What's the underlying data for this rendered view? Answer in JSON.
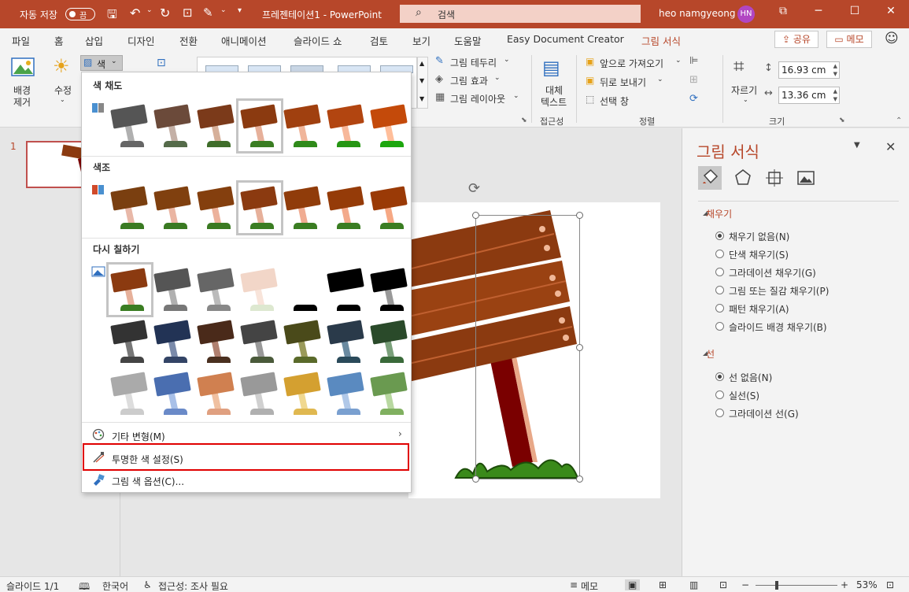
{
  "titlebar": {
    "autosave_label": "자동 저장",
    "autosave_state": "끔",
    "doc_title": "프레젠테이션1  -  PowerPoint",
    "search_placeholder": "검색",
    "user_name": "heo namgyeong",
    "user_initials": "HN",
    "accent": "#b7472a"
  },
  "tabs": [
    "파일",
    "홈",
    "삽입",
    "디자인",
    "전환",
    "애니메이션",
    "슬라이드 쇼",
    "검토",
    "보기",
    "도움말",
    "Easy Document Creator",
    "그림 서식"
  ],
  "active_tab": "그림 서식",
  "share_label": "공유",
  "memo_label": "메모",
  "ribbon": {
    "bg_remove": "배경\n제거",
    "bg_remove_l1": "배경",
    "bg_remove_l2": "제거",
    "correct": "수정",
    "color": "색",
    "picture_border": "그림 테두리",
    "picture_effects": "그림 효과",
    "picture_layout": "그림 레이아웃",
    "alt_text_l1": "대체",
    "alt_text_l2": "텍스트",
    "accessibility_group": "접근성",
    "bring_forward": "앞으로 가져오기",
    "send_backward": "뒤로 보내기",
    "selection_pane": "선택 창",
    "arrange_group": "정렬",
    "crop": "자르기",
    "height_value": "16.93 cm",
    "width_value": "13.36 cm",
    "size_group": "크기"
  },
  "slide_number": "1",
  "dropdown": {
    "saturation_title": "색 채도",
    "tone_title": "색조",
    "recolor_title": "다시 칠하기",
    "more_variations": "기타 변형(M)",
    "set_transparent": "투명한 색 설정(S)",
    "color_options": "그림 색 옵션(C)...",
    "saturation_swatches": [
      {
        "board": "#555555",
        "post": "#b0b0b0",
        "grass": "#666666"
      },
      {
        "board": "#6b4a3a",
        "post": "#c4b0a6",
        "grass": "#556b4a"
      },
      {
        "board": "#7b3a1a",
        "post": "#d6b09a",
        "grass": "#3f6d2a"
      },
      {
        "board": "#8b3a10",
        "post": "#e6b09a",
        "grass": "#3a7d22"
      },
      {
        "board": "#a0400f",
        "post": "#f0b59a",
        "grass": "#2f8a1a"
      },
      {
        "board": "#b24510",
        "post": "#f7b89a",
        "grass": "#269614"
      },
      {
        "board": "#c44a0a",
        "post": "#ffbe9a",
        "grass": "#1da60e"
      }
    ],
    "tone_swatches": [
      {
        "board": "#7a3f10",
        "post": "#e8b8a8",
        "grass": "#3a7a22"
      },
      {
        "board": "#80400f",
        "post": "#eab5a2",
        "grass": "#3a7a22"
      },
      {
        "board": "#843f0e",
        "post": "#ecb29c",
        "grass": "#3a7a22"
      },
      {
        "board": "#8b3a10",
        "post": "#e6b09a",
        "grass": "#3a7d22"
      },
      {
        "board": "#903c0a",
        "post": "#f0ac92",
        "grass": "#3a7d22"
      },
      {
        "board": "#953b08",
        "post": "#f3aa8c",
        "grass": "#3a7d22"
      },
      {
        "board": "#9a3a06",
        "post": "#f6a884",
        "grass": "#3a7d22"
      }
    ],
    "recolor_swatches": [
      {
        "board": "#8b3a10",
        "post": "#e6b09a",
        "grass": "#3a7d22"
      },
      {
        "board": "#555555",
        "post": "#b0b0b0",
        "grass": "#777777"
      },
      {
        "board": "#666666",
        "post": "#bbbbbb",
        "grass": "#888888"
      },
      {
        "board": "#f2d6c8",
        "post": "#f8e4da",
        "grass": "#dde8d0"
      },
      {
        "board": "#ffffff",
        "post": "#ffffff",
        "grass": "#000000"
      },
      {
        "board": "#000000",
        "post": "#ffffff",
        "grass": "#000000"
      },
      {
        "board": "#000000",
        "post": "#999999",
        "grass": "#000000"
      },
      {
        "board": "#333333",
        "post": "#777777",
        "grass": "#444444"
      },
      {
        "board": "#223355",
        "post": "#7a8aaa",
        "grass": "#334466"
      },
      {
        "board": "#4a2a1a",
        "post": "#b08070",
        "grass": "#4a3020"
      },
      {
        "board": "#444444",
        "post": "#999999",
        "grass": "#4a5a3a"
      },
      {
        "board": "#4a4a1a",
        "post": "#9a9a5a",
        "grass": "#5a6a2a"
      },
      {
        "board": "#2a3a4a",
        "post": "#6a8aa0",
        "grass": "#2a4a5a"
      },
      {
        "board": "#2a4a2a",
        "post": "#7aa07a",
        "grass": "#3a6a3a"
      },
      {
        "board": "#aaaaaa",
        "post": "#dddddd",
        "grass": "#cccccc"
      },
      {
        "board": "#4a6eb0",
        "post": "#a8c0e8",
        "grass": "#6a8ac8"
      },
      {
        "board": "#d08050",
        "post": "#f0c0a0",
        "grass": "#e0a080"
      },
      {
        "board": "#999999",
        "post": "#d0d0d0",
        "grass": "#b0b0b0"
      },
      {
        "board": "#d4a030",
        "post": "#f0d890",
        "grass": "#e0b850"
      },
      {
        "board": "#5a8ac0",
        "post": "#b0c8e8",
        "grass": "#7aa0d0"
      },
      {
        "board": "#6a9a50",
        "post": "#b8d8a0",
        "grass": "#80b060"
      }
    ]
  },
  "format_pane": {
    "title": "그림 서식",
    "fill_section": "채우기",
    "fill_options": [
      "채우기 없음(N)",
      "단색 채우기(S)",
      "그라데이션 채우기(G)",
      "그림 또는 질감 채우기(P)",
      "패턴 채우기(A)",
      "슬라이드 배경 채우기(B)"
    ],
    "fill_selected": 0,
    "line_section": "선",
    "line_options": [
      "선 없음(N)",
      "실선(S)",
      "그라데이션 선(G)"
    ],
    "line_selected": 0
  },
  "statusbar": {
    "slide_info": "슬라이드 1/1",
    "language": "한국어",
    "accessibility": "접근성: 조사 필요",
    "notes": "메모",
    "zoom": "53%"
  }
}
